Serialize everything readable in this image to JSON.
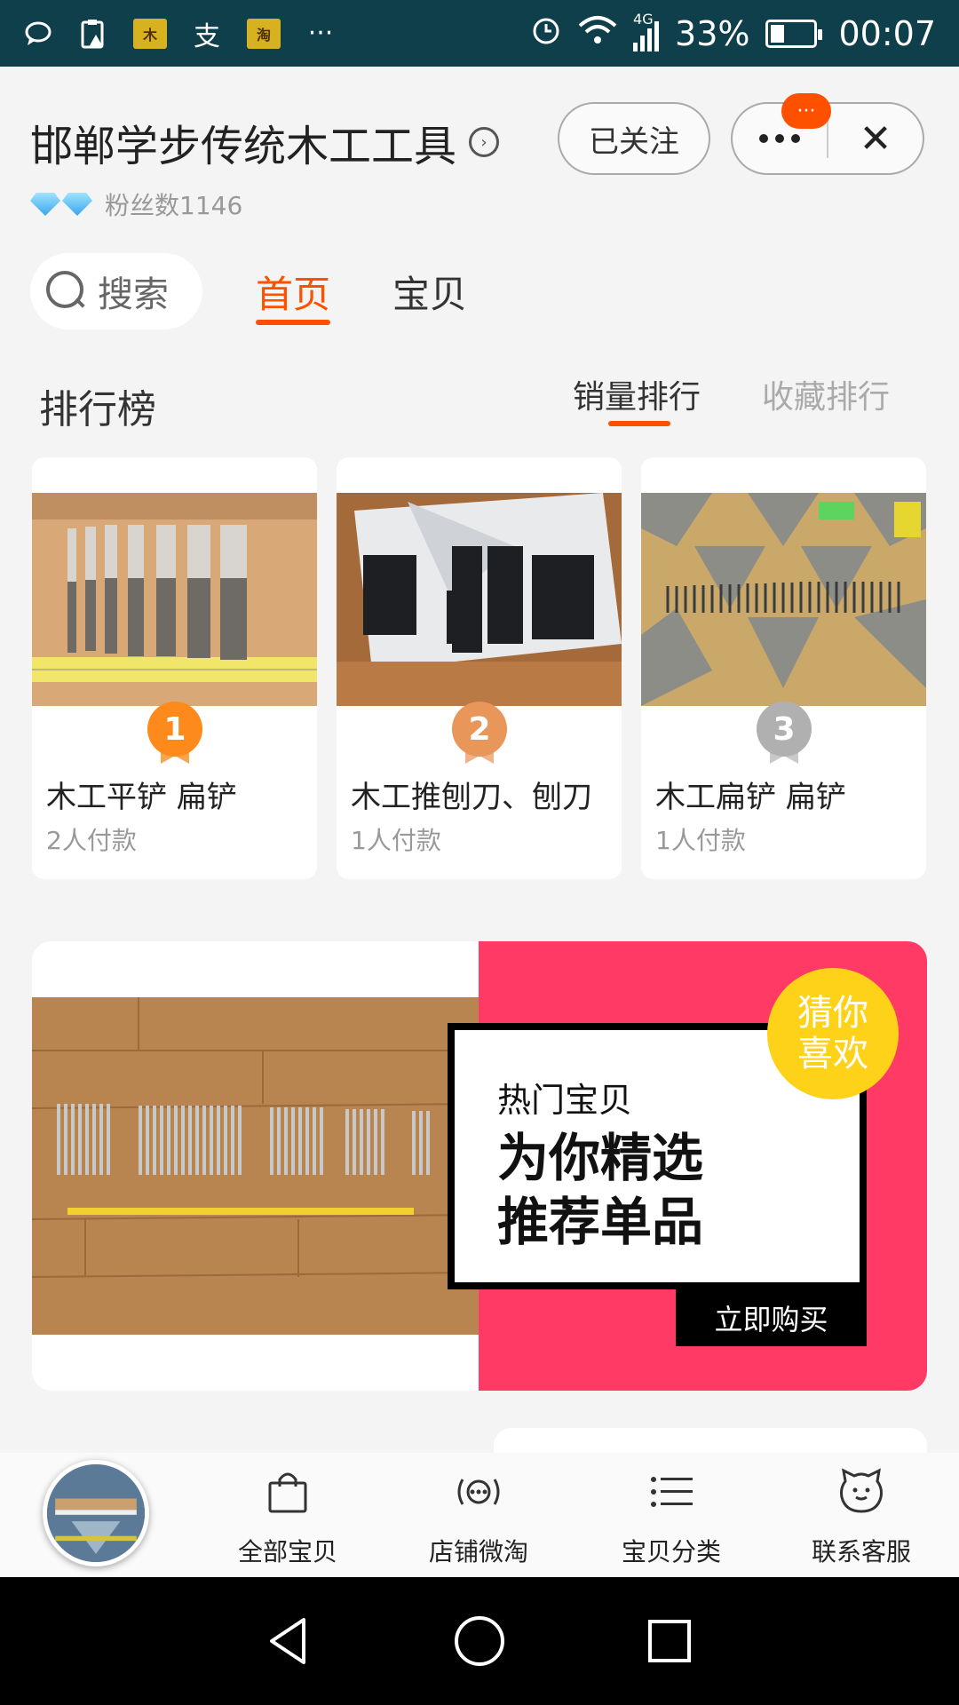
{
  "status_bar": {
    "time": "00:07",
    "battery_level": 0.33,
    "battery_text": "33%",
    "network": "4G",
    "more": "···",
    "app_icons": [
      "chat-icon",
      "clipboard-alert-icon",
      "shop-app-icon",
      "alipay-icon",
      "taobao-app-icon"
    ],
    "app_icon_text": {
      "alipay": "支"
    }
  },
  "header": {
    "shop_name": "邯郸学步传统木工工具",
    "fans_label": "粉丝数1146",
    "follow_label": "已关注",
    "notify_badge": "···",
    "close_label": "✕"
  },
  "nav": {
    "search_label": "搜索",
    "tabs": [
      {
        "label": "首页",
        "active": true
      },
      {
        "label": "宝贝",
        "active": false
      }
    ]
  },
  "ranking": {
    "title": "排行榜",
    "tabs": [
      {
        "label": "销量排行",
        "active": true
      },
      {
        "label": "收藏排行",
        "active": false
      }
    ],
    "items": [
      {
        "rank": "1",
        "name": "木工平铲 扁铲",
        "sales": "2人付款",
        "medal_color": "#ff8a1c"
      },
      {
        "rank": "2",
        "name": "木工推刨刀、刨刀",
        "sales": "1人付款",
        "medal_color": "#e8965a"
      },
      {
        "rank": "3",
        "name": "木工扁铲 扁铲",
        "sales": "1人付款",
        "medal_color": "#b0b0b0"
      }
    ]
  },
  "banner": {
    "badge": "猜你喜欢",
    "heading_small": "热门宝贝",
    "heading_big_1": "为你精选",
    "heading_big_2": "推荐单品",
    "cta": "立即购买",
    "accent_color": "#ff3a64"
  },
  "toolbar": {
    "items": [
      {
        "label": "全部宝贝",
        "icon": "shopping-bag-icon"
      },
      {
        "label": "店铺微淘",
        "icon": "broadcast-icon"
      },
      {
        "label": "宝贝分类",
        "icon": "list-icon"
      },
      {
        "label": "联系客服",
        "icon": "chat-face-icon"
      }
    ]
  },
  "colors": {
    "accent": "#ff5000",
    "status_bar": "#0f3f4a"
  }
}
